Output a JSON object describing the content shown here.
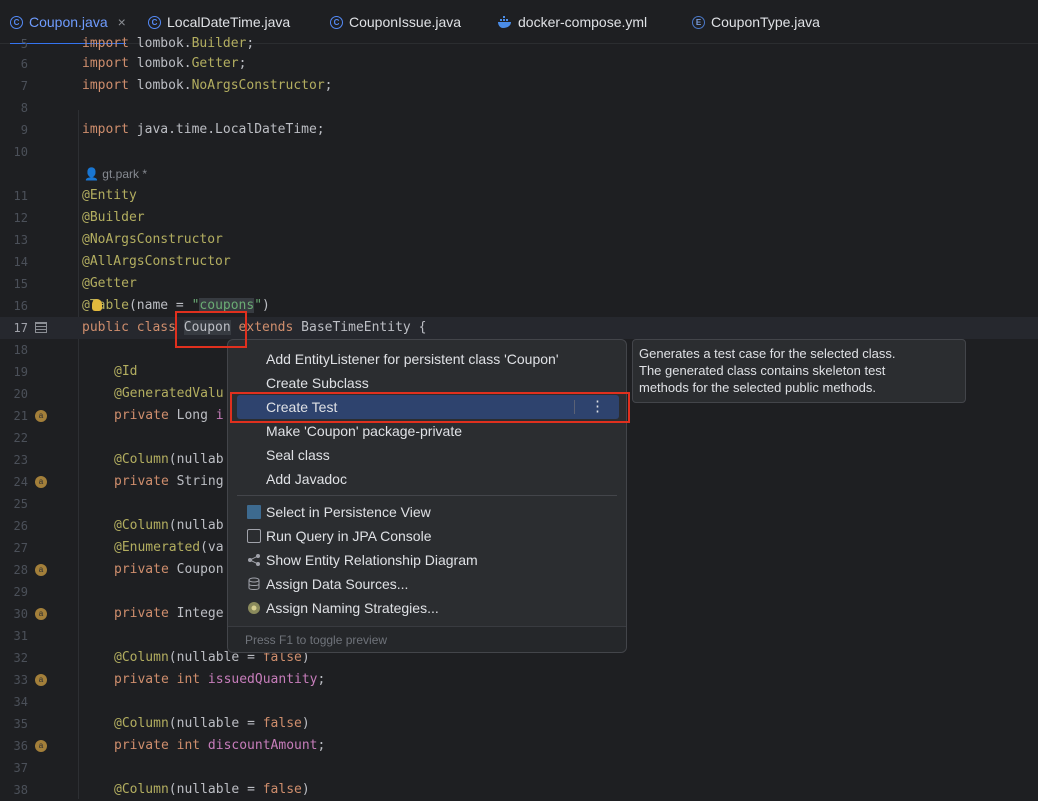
{
  "tabs": [
    {
      "label": "Coupon.java",
      "active": true,
      "icon": "class-icon"
    },
    {
      "label": "LocalDateTime.java",
      "active": false,
      "icon": "class-icon"
    },
    {
      "label": "CouponIssue.java",
      "active": false,
      "icon": "class-icon"
    },
    {
      "label": "docker-compose.yml",
      "active": false,
      "icon": "docker-icon"
    },
    {
      "label": "CouponType.java",
      "active": false,
      "icon": "enum-icon"
    }
  ],
  "tab_close_glyph": "×",
  "editor": {
    "lines": [
      {
        "n": "5",
        "text": "import lombok.Builder;"
      },
      {
        "n": "6",
        "text": "import lombok.Getter;"
      },
      {
        "n": "7",
        "text": "import lombok.NoArgsConstructor;"
      },
      {
        "n": "8",
        "text": ""
      },
      {
        "n": "9",
        "text": "import java.time.LocalDateTime;"
      },
      {
        "n": "10",
        "text": ""
      },
      {
        "n": "11",
        "text": "@Entity"
      },
      {
        "n": "12",
        "text": "@Builder"
      },
      {
        "n": "13",
        "text": "@NoArgsConstructor"
      },
      {
        "n": "14",
        "text": "@AllArgsConstructor"
      },
      {
        "n": "15",
        "text": "@Getter"
      },
      {
        "n": "16",
        "text": "@Table(name = \"coupons\")"
      },
      {
        "n": "17",
        "text": "public class Coupon extends BaseTimeEntity {"
      },
      {
        "n": "18",
        "text": ""
      },
      {
        "n": "19",
        "text": "@Id"
      },
      {
        "n": "20",
        "text": "@GeneratedValu"
      },
      {
        "n": "21",
        "text": "private Long i"
      },
      {
        "n": "22",
        "text": ""
      },
      {
        "n": "23",
        "text": "@Column(nullab"
      },
      {
        "n": "24",
        "text": "private String"
      },
      {
        "n": "25",
        "text": ""
      },
      {
        "n": "26",
        "text": "@Column(nullab"
      },
      {
        "n": "27",
        "text": "@Enumerated(va"
      },
      {
        "n": "28",
        "text": "private Coupon"
      },
      {
        "n": "29",
        "text": ""
      },
      {
        "n": "30",
        "text": "private Intege"
      },
      {
        "n": "31",
        "text": ""
      },
      {
        "n": "32",
        "text": "@Column(nullable = false)"
      },
      {
        "n": "33",
        "text": "private int issuedQuantity;"
      },
      {
        "n": "34",
        "text": ""
      },
      {
        "n": "35",
        "text": "@Column(nullable = false)"
      },
      {
        "n": "36",
        "text": "private int discountAmount;"
      },
      {
        "n": "37",
        "text": ""
      },
      {
        "n": "38",
        "text": "@Column(nullable = false)"
      }
    ],
    "author_inlay": "gt.park *",
    "gutter_marker": "a"
  },
  "intention_menu": {
    "items": [
      {
        "label": "Add EntityListener for persistent class 'Coupon'",
        "icon": ""
      },
      {
        "label": "Create Subclass",
        "icon": ""
      },
      {
        "label": "Create Test",
        "icon": "",
        "selected": true
      },
      {
        "label": "Make 'Coupon' package-private",
        "icon": ""
      },
      {
        "label": "Seal class",
        "icon": ""
      },
      {
        "label": "Add Javadoc",
        "icon": ""
      },
      {
        "label": "Select in Persistence View",
        "icon": "persistence-view-icon"
      },
      {
        "label": "Run Query in JPA Console",
        "icon": "jpa-console-icon"
      },
      {
        "label": "Show Entity Relationship Diagram",
        "icon": "diagram-icon"
      },
      {
        "label": "Assign Data Sources...",
        "icon": "database-icon"
      },
      {
        "label": "Assign Naming Strategies...",
        "icon": "naming-strategy-icon"
      }
    ],
    "more_glyph": "⋮",
    "footer": "Press F1 to toggle preview"
  },
  "tooltip": {
    "lines": [
      "Generates a test case for the selected class.",
      "The generated class contains skeleton test",
      "methods for the selected public methods."
    ]
  },
  "colors": {
    "highlight_red": "#e0301e",
    "selection": "#2e436e",
    "accent": "#3574f0"
  }
}
